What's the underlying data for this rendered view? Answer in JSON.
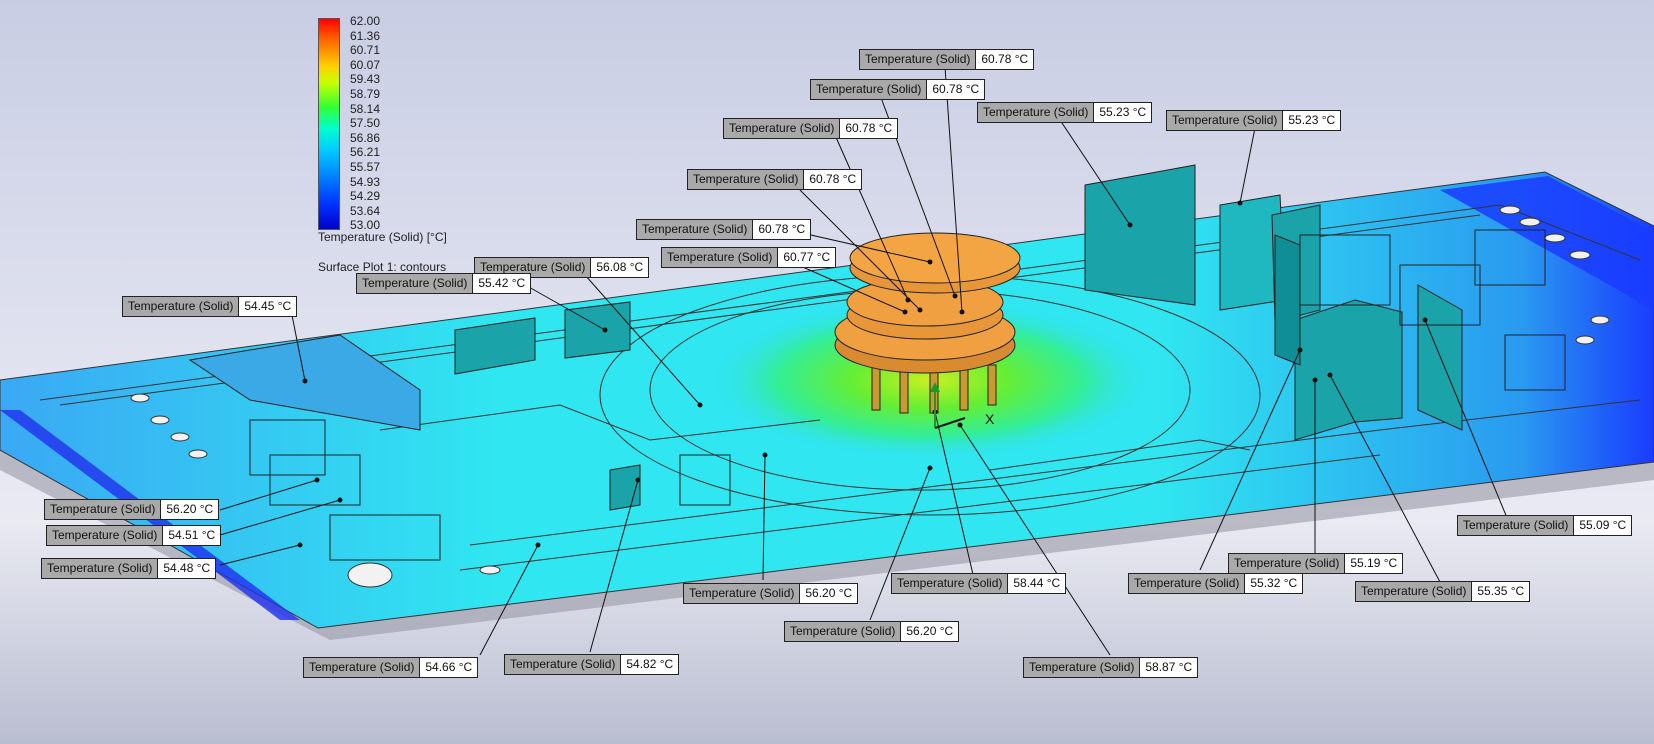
{
  "legend": {
    "values": [
      "62.00",
      "61.36",
      "60.71",
      "60.07",
      "59.43",
      "58.79",
      "58.14",
      "57.50",
      "56.86",
      "56.21",
      "55.57",
      "54.93",
      "54.29",
      "53.64",
      "53.00"
    ],
    "title": "Temperature (Solid) [°C]",
    "plot_name": "Surface Plot 1: contours"
  },
  "probe_label": "Temperature (Solid)",
  "probes": [
    {
      "value": "60.78 °C"
    },
    {
      "value": "60.78 °C"
    },
    {
      "value": "55.23 °C"
    },
    {
      "value": "55.23 °C"
    },
    {
      "value": "60.78 °C"
    },
    {
      "value": "60.78 °C"
    },
    {
      "value": "60.78 °C"
    },
    {
      "value": "60.77 °C"
    },
    {
      "value": "56.08 °C"
    },
    {
      "value": "55.42 °C"
    },
    {
      "value": "54.45 °C"
    },
    {
      "value": "56.20 °C"
    },
    {
      "value": "54.51 °C"
    },
    {
      "value": "54.48 °C"
    },
    {
      "value": "55.09 °C"
    },
    {
      "value": "55.19 °C"
    },
    {
      "value": "58.44 °C"
    },
    {
      "value": "55.32 °C"
    },
    {
      "value": "56.20 °C"
    },
    {
      "value": "55.35 °C"
    },
    {
      "value": "56.20 °C"
    },
    {
      "value": "54.66 °C"
    },
    {
      "value": "54.82 °C"
    },
    {
      "value": "58.87 °C"
    }
  ],
  "colors": {
    "board": "#33d6f0",
    "board_edge": "#1a3cff",
    "hot": "#9ae22a",
    "disk": "#f0a040",
    "heatsink": "#1aa3a8"
  }
}
